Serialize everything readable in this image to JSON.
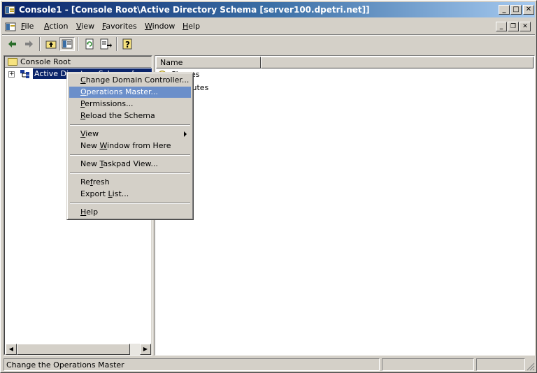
{
  "window": {
    "title": "Console1 - [Console Root\\Active Directory Schema [server100.dpetri.net]]",
    "caption_buttons": [
      "minimize",
      "maximize",
      "close"
    ]
  },
  "menubar": {
    "items": [
      "File",
      "Action",
      "View",
      "Favorites",
      "Window",
      "Help"
    ]
  },
  "toolbar": {
    "buttons": [
      "back-icon",
      "forward-icon",
      "up-one-level-icon",
      "show-hide-tree-icon",
      "refresh-icon",
      "export-list-icon",
      "help-icon"
    ]
  },
  "tree": {
    "root_label": "Console Root",
    "child_label": "Active Directory Schema [server100.dpetri.net]"
  },
  "list": {
    "columns": [
      "Name",
      ""
    ],
    "rows": [
      "Classes",
      "Attributes"
    ]
  },
  "context_menu": {
    "items": [
      {
        "pre": "",
        "acc": "C",
        "post": "hange Domain Controller..."
      },
      {
        "pre": "",
        "acc": "O",
        "post": "perations Master..."
      },
      {
        "pre": "",
        "acc": "P",
        "post": "ermissions..."
      },
      {
        "pre": "",
        "acc": "R",
        "post": "eload the Schema"
      },
      {
        "pre": "",
        "acc": "V",
        "post": "iew"
      },
      {
        "pre": "New ",
        "acc": "W",
        "post": "indow from Here"
      },
      {
        "pre": "New ",
        "acc": "T",
        "post": "askpad View..."
      },
      {
        "pre": "Re",
        "acc": "f",
        "post": "resh"
      },
      {
        "pre": "Export ",
        "acc": "L",
        "post": "ist..."
      },
      {
        "pre": "",
        "acc": "H",
        "post": "elp"
      }
    ],
    "highlighted_index": 1
  },
  "statusbar": {
    "text": "Change the Operations Master"
  },
  "colors": {
    "title_gradient_start": "#0a246a",
    "title_gradient_end": "#a6caf0",
    "face": "#d4d0c8",
    "selection": "#0a246a",
    "menu_highlight": "#6b8fca"
  }
}
